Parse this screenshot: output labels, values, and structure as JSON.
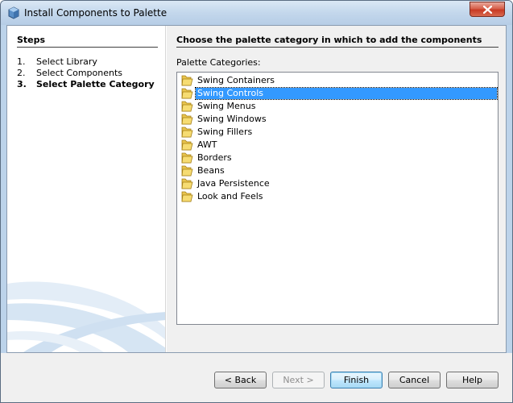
{
  "window": {
    "title": "Install Components to Palette",
    "icon": "netbeans-cube-icon",
    "frame_color": "#bcd3ea"
  },
  "steps": {
    "heading": "Steps",
    "items": [
      {
        "num": "1.",
        "label": "Select Library",
        "current": false
      },
      {
        "num": "2.",
        "label": "Select Components",
        "current": false
      },
      {
        "num": "3.",
        "label": "Select Palette Category",
        "current": true
      }
    ]
  },
  "main": {
    "heading": "Choose the palette category in which to add the components",
    "list_label": "Palette Categories:",
    "categories": [
      {
        "label": "Swing Containers",
        "selected": false
      },
      {
        "label": "Swing Controls",
        "selected": true
      },
      {
        "label": "Swing Menus",
        "selected": false
      },
      {
        "label": "Swing Windows",
        "selected": false
      },
      {
        "label": "Swing Fillers",
        "selected": false
      },
      {
        "label": "AWT",
        "selected": false
      },
      {
        "label": "Borders",
        "selected": false
      },
      {
        "label": "Beans",
        "selected": false
      },
      {
        "label": "Java Persistence",
        "selected": false
      },
      {
        "label": "Look and Feels",
        "selected": false
      }
    ],
    "selection_color": "#3399ff",
    "item_icon": "folder-icon"
  },
  "buttons": {
    "back": "< Back",
    "next": "Next >",
    "finish": "Finish",
    "cancel": "Cancel",
    "help": "Help"
  }
}
